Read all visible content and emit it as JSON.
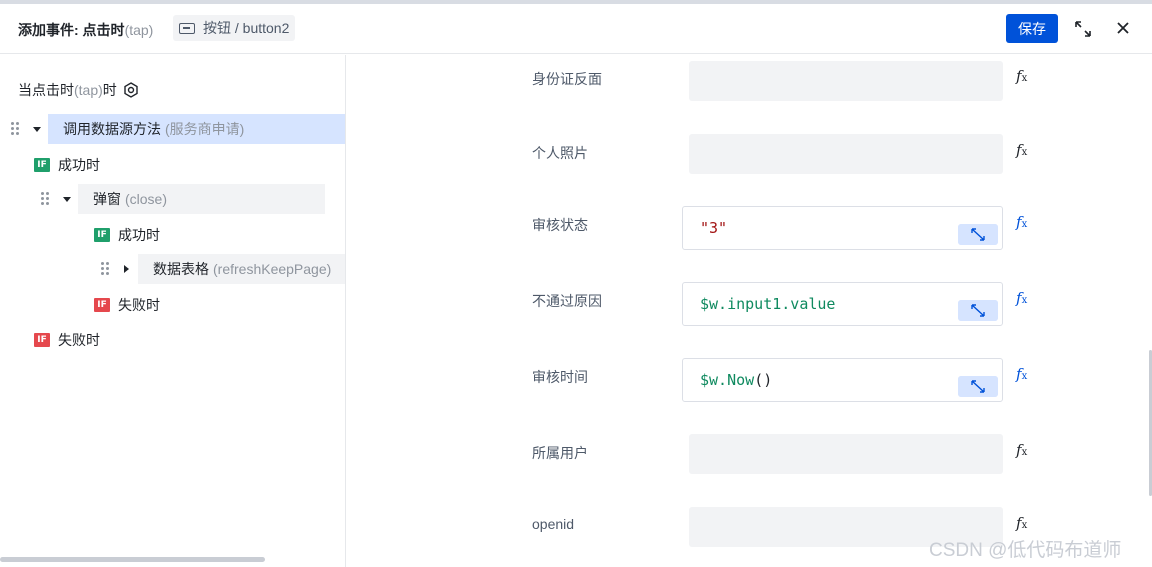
{
  "header": {
    "title": "添加事件: 点击时",
    "title_suffix": "(tap)",
    "component_type": "按钮",
    "component_sep": " / ",
    "component_id": "button2",
    "save_label": "保存",
    "icons": [
      "component-button-icon",
      "expand-icon",
      "close-icon"
    ]
  },
  "left": {
    "trigger_label": "当点击时",
    "trigger_tap": "(tap)",
    "trigger_suffix": "时",
    "tree": {
      "root_action": "调用数据源方法",
      "root_action_detail": "(服务商申请)",
      "success1": "成功时",
      "popup_action": "弹窗",
      "popup_action_detail": "(close)",
      "success2": "成功时",
      "table_action": "数据表格",
      "table_action_detail": "(refreshKeepPage)",
      "fail2": "失败时",
      "fail1": "失败时",
      "if_badge": "IF"
    }
  },
  "fields": [
    {
      "label": "身份证反面",
      "value": "",
      "kind": "empty"
    },
    {
      "label": "个人照片",
      "value": "",
      "kind": "empty"
    },
    {
      "label": "审核状态",
      "value": "\"3\"",
      "kind": "string"
    },
    {
      "label": "不通过原因",
      "value": "$w.input1.value",
      "kind": "variable"
    },
    {
      "label": "审核时间",
      "value_fn": "$w.Now",
      "value_parens": "()",
      "kind": "call"
    },
    {
      "label": "所属用户",
      "value": "",
      "kind": "empty"
    },
    {
      "label": "openid",
      "value": "",
      "kind": "empty"
    }
  ],
  "fx_label": "f",
  "fx_sub": "x",
  "colors": {
    "primary": "#0052d9",
    "success_badge": "#1f9f6b",
    "fail_badge": "#e5484d",
    "selected_row": "#d6e4ff",
    "string_value": "#a31515",
    "variable_value": "#0f8a5f"
  },
  "watermark": "CSDN @低代码布道师"
}
